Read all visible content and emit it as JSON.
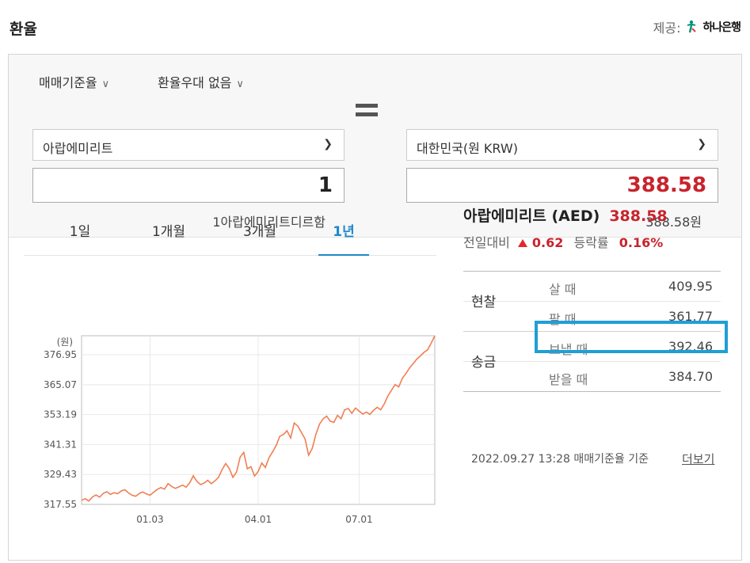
{
  "header": {
    "title": "환율",
    "provider_label": "제공:",
    "provider_name": "하나은행"
  },
  "options": {
    "rate_type": "매매기준율",
    "preferential": "환율우대 없음"
  },
  "converter": {
    "from_currency": "아랍에미리트",
    "from_amount": "1",
    "from_caption": "1아랍에미리트디르함",
    "to_currency": "대한민국(원 KRW)",
    "to_amount": "388.58",
    "to_caption": "388.58원"
  },
  "tabs": [
    "1일",
    "1개월",
    "3개월",
    "1년"
  ],
  "active_tab": "1년",
  "info": {
    "currency_name": "아랍에미리트 (AED)",
    "rate": "388.58",
    "change_label": "전일대비",
    "change_value": "0.62",
    "change_rate_label": "등락률",
    "change_rate_value": "0.16%",
    "change_direction": "up"
  },
  "table": {
    "cash_group": "현찰",
    "remit_group": "송금",
    "rows": [
      {
        "label": "살 때",
        "value": "409.95"
      },
      {
        "label": "팔 때",
        "value": "361.77"
      },
      {
        "label": "보낼 때",
        "value": "392.46"
      },
      {
        "label": "받을 때",
        "value": "384.70"
      }
    ]
  },
  "footer": {
    "timestamp": "2022.09.27 13:28 매매기준율 기준",
    "more": "더보기"
  },
  "colors": {
    "accent": "#1e88c8",
    "up_red": "#c8232c",
    "line": "#f07f52",
    "highlight": "#1f9fd6"
  },
  "chart_data": {
    "type": "line",
    "unit_label": "(원)",
    "y_ticks": [
      317.55,
      329.43,
      341.31,
      353.19,
      365.07,
      376.95
    ],
    "x_ticks": [
      "01.03",
      "04.01",
      "07.01"
    ],
    "ylim": [
      317.55,
      384.5
    ],
    "x_tick_positions": [
      19,
      49,
      77
    ],
    "values": [
      319.2,
      319.8,
      318.9,
      320.5,
      321.3,
      320.4,
      321.9,
      322.6,
      321.5,
      322.2,
      321.8,
      322.9,
      323.4,
      322.1,
      321.2,
      320.8,
      321.9,
      322.5,
      321.7,
      321.2,
      322.4,
      323.5,
      324.2,
      323.6,
      325.8,
      324.7,
      323.9,
      324.5,
      325.2,
      324.4,
      326.1,
      328.9,
      326.7,
      325.4,
      326.0,
      327.1,
      325.8,
      326.9,
      328.3,
      331.4,
      333.8,
      331.7,
      328.3,
      330.4,
      336.3,
      338.2,
      331.7,
      332.5,
      328.8,
      330.6,
      334.0,
      332.2,
      336.1,
      338.4,
      341.0,
      344.6,
      345.3,
      346.8,
      343.9,
      349.9,
      348.6,
      346.1,
      343.5,
      337.1,
      339.8,
      345.3,
      349.4,
      351.5,
      352.6,
      350.6,
      350.1,
      352.9,
      351.6,
      355.1,
      355.6,
      353.7,
      355.8,
      354.6,
      353.4,
      354.2,
      353.3,
      354.9,
      356.1,
      355.1,
      357.5,
      360.6,
      362.9,
      365.1,
      364.2,
      367.6,
      369.5,
      371.7,
      373.4,
      375.2,
      376.5,
      377.9,
      378.9,
      381.5,
      384.5
    ]
  }
}
